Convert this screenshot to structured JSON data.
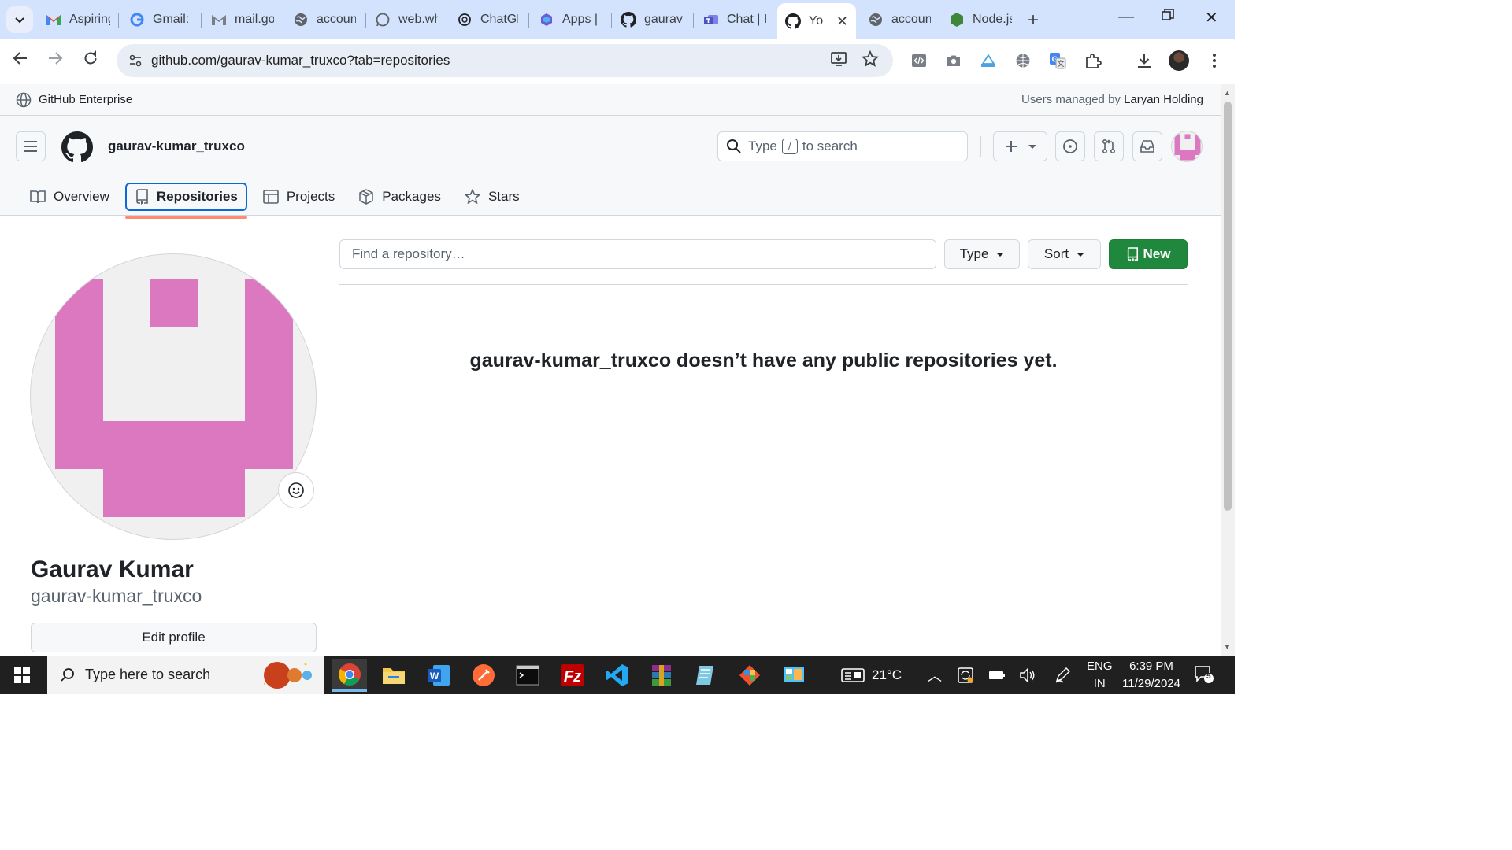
{
  "browser": {
    "tabs": [
      {
        "label": "Aspiring",
        "icon": "gmail-icon"
      },
      {
        "label": "Gmail: I",
        "icon": "google-icon"
      },
      {
        "label": "mail.go",
        "icon": "gmail-gray-icon"
      },
      {
        "label": "accoun",
        "icon": "globe-icon"
      },
      {
        "label": "web.wh",
        "icon": "whatsapp-icon"
      },
      {
        "label": "ChatGP",
        "icon": "chatgpt-icon"
      },
      {
        "label": "Apps | I",
        "icon": "apps-icon"
      },
      {
        "label": "gaurav",
        "icon": "github-icon"
      },
      {
        "label": "Chat | I",
        "icon": "teams-icon"
      },
      {
        "label": "Yo",
        "icon": "github-icon",
        "active": true
      },
      {
        "label": "accoun",
        "icon": "globe-icon"
      },
      {
        "label": "Node.js",
        "icon": "nodejs-icon"
      }
    ],
    "url": "github.com/gaurav-kumar_truxco?tab=repositories"
  },
  "enterprise_banner": {
    "left": "GitHub Enterprise",
    "right_prefix": "Users managed by",
    "right_org": "Laryan Holding"
  },
  "header": {
    "username": "gaurav-kumar_truxco",
    "search_prefix": "Type",
    "search_key": "/",
    "search_suffix": "to search"
  },
  "profile_tabs": [
    {
      "label": "Overview",
      "icon": "book-icon"
    },
    {
      "label": "Repositories",
      "icon": "repo-icon",
      "active": true
    },
    {
      "label": "Projects",
      "icon": "table-icon"
    },
    {
      "label": "Packages",
      "icon": "package-icon"
    },
    {
      "label": "Stars",
      "icon": "star-icon"
    }
  ],
  "profile": {
    "full_name": "Gaurav Kumar",
    "login": "gaurav-kumar_truxco",
    "edit_label": "Edit profile"
  },
  "repos": {
    "filter_placeholder": "Find a repository…",
    "type_label": "Type",
    "sort_label": "Sort",
    "new_label": "New",
    "empty_message": "gaurav-kumar_truxco doesn’t have any public repositories yet."
  },
  "colors": {
    "identicon": "#db78c0",
    "primary_button": "#1f883d",
    "tab_underline": "#fd8c73",
    "focus_ring": "#0969da"
  },
  "taskbar": {
    "search_placeholder": "Type here to search",
    "weather": "21°C",
    "lang_top": "ENG",
    "lang_bottom": "IN",
    "time": "6:39 PM",
    "date": "11/29/2024",
    "notifications": "5"
  }
}
